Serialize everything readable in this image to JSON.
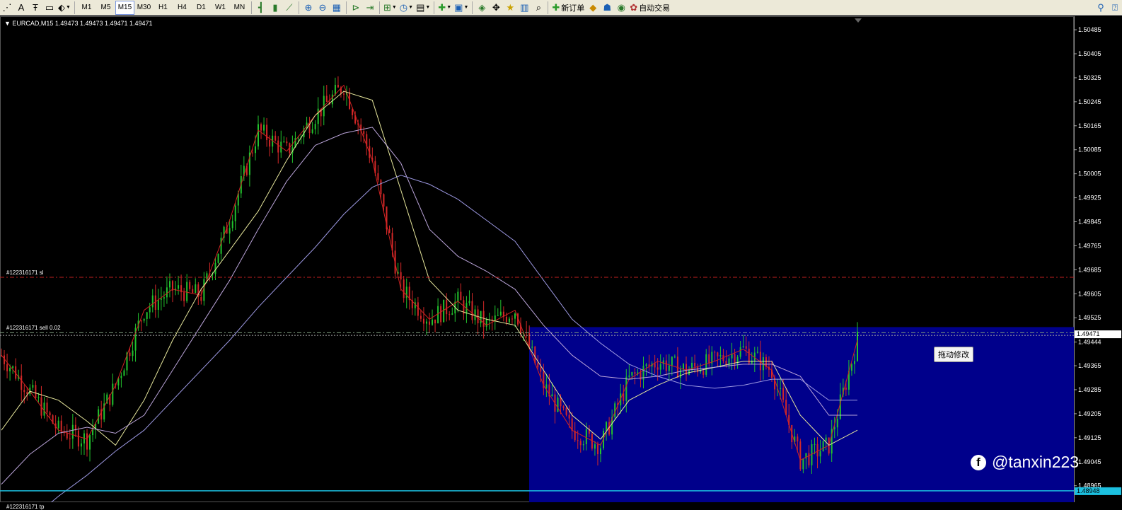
{
  "toolbar": {
    "timeframes": [
      "M1",
      "M5",
      "M15",
      "M30",
      "H1",
      "H4",
      "D1",
      "W1",
      "MN"
    ],
    "active_timeframe": "M15",
    "new_order_label": "新订单",
    "auto_trade_label": "自动交易"
  },
  "chart": {
    "header": "▼ EURCAD,M15  1.49473 1.49473 1.49471 1.49471",
    "sl_label": "#122316171 sl",
    "sell_label": "#122316171 sell 0.02",
    "tp_label": "#122316171 tp",
    "current_price": "1.49471",
    "cyan_price": "1.48948",
    "tooltip": "拖动修改",
    "watermark": "@tanxin223",
    "price_ticks": [
      "1.50485",
      "1.50405",
      "1.50325",
      "1.50245",
      "1.50165",
      "1.50085",
      "1.50005",
      "1.49925",
      "1.49845",
      "1.49765",
      "1.49685",
      "1.49605",
      "1.49525",
      "1.49444",
      "1.49365",
      "1.49285",
      "1.49205",
      "1.49125",
      "1.49045",
      "1.48965"
    ]
  },
  "chart_data": {
    "type": "line",
    "symbol": "EURCAD",
    "timeframe": "M15",
    "ylim": [
      1.4891,
      1.5053
    ],
    "x": [
      0,
      40,
      80,
      120,
      160,
      200,
      240,
      280,
      320,
      360,
      400,
      440,
      480,
      520,
      560,
      600,
      640,
      680,
      720,
      760,
      800,
      840,
      880,
      920,
      960,
      1000,
      1040,
      1080,
      1120,
      1160,
      1200
    ],
    "series": [
      {
        "values": [
          1.494,
          1.4928,
          1.4915,
          1.4912,
          1.493,
          1.4955,
          1.4962,
          1.496,
          1.4985,
          1.5015,
          1.5008,
          1.502,
          1.503,
          1.5005,
          1.4962,
          1.4952,
          1.4958,
          1.495,
          1.4955,
          1.493,
          1.4915,
          1.491,
          1.4932,
          1.4938,
          1.4935,
          1.4938,
          1.4942,
          1.4935,
          1.4905,
          1.491,
          1.4945
        ]
      },
      {
        "values": [
          1.4915,
          1.4928,
          1.4925,
          1.4918,
          1.491,
          1.4925,
          1.4945,
          1.4962,
          1.4975,
          1.4988,
          1.5005,
          1.502,
          1.5028,
          1.5025,
          1.4995,
          1.4965,
          1.4955,
          1.4952,
          1.495,
          1.4935,
          1.492,
          1.4912,
          1.4925,
          1.493,
          1.4934,
          1.4936,
          1.4938,
          1.4938,
          1.492,
          1.491,
          1.4915
        ]
      },
      {
        "values": [
          1.4897,
          1.4907,
          1.4914,
          1.4916,
          1.4914,
          1.492,
          1.4935,
          1.495,
          1.4965,
          1.4982,
          1.4998,
          1.501,
          1.5014,
          1.5016,
          1.5004,
          1.4982,
          1.4973,
          1.4968,
          1.4962,
          1.495,
          1.494,
          1.4933,
          1.4932,
          1.4933,
          1.4935,
          1.4936,
          1.4937,
          1.4937,
          1.4933,
          1.492,
          1.492
        ]
      },
      {
        "values": [
          1.488,
          1.4885,
          1.4893,
          1.49,
          1.4908,
          1.4915,
          1.4925,
          1.4935,
          1.4945,
          1.4956,
          1.4966,
          1.4976,
          1.4987,
          1.4996,
          1.5,
          1.4997,
          1.4992,
          1.4985,
          1.4978,
          1.4965,
          1.4952,
          1.4944,
          1.4937,
          1.4933,
          1.493,
          1.4929,
          1.493,
          1.4932,
          1.4932,
          1.4925,
          1.4925
        ]
      }
    ],
    "price_ticks": [
      1.50485,
      1.50405,
      1.50325,
      1.50245,
      1.50165,
      1.50085,
      1.50005,
      1.49925,
      1.49845,
      1.49765,
      1.49685,
      1.49605,
      1.49525,
      1.49444,
      1.49365,
      1.49285,
      1.49205,
      1.49125,
      1.49045,
      1.48965
    ],
    "stop_loss": 1.4966,
    "sell_entry": 1.49475,
    "take_profit": 1.4888,
    "current_price": 1.49471,
    "cyan_level": 1.48948,
    "colors": {
      "background": "#000000",
      "bull_candle": "#22c32e",
      "bear_candle": "#d42828",
      "ma_fast": "#d02222",
      "ma_mid": "#e7e79c",
      "ma_slow": "#b9a3d8",
      "ma_long": "#9b97e0",
      "order_zone": "#00008b",
      "cyan_line": "#1cc0e0"
    }
  }
}
